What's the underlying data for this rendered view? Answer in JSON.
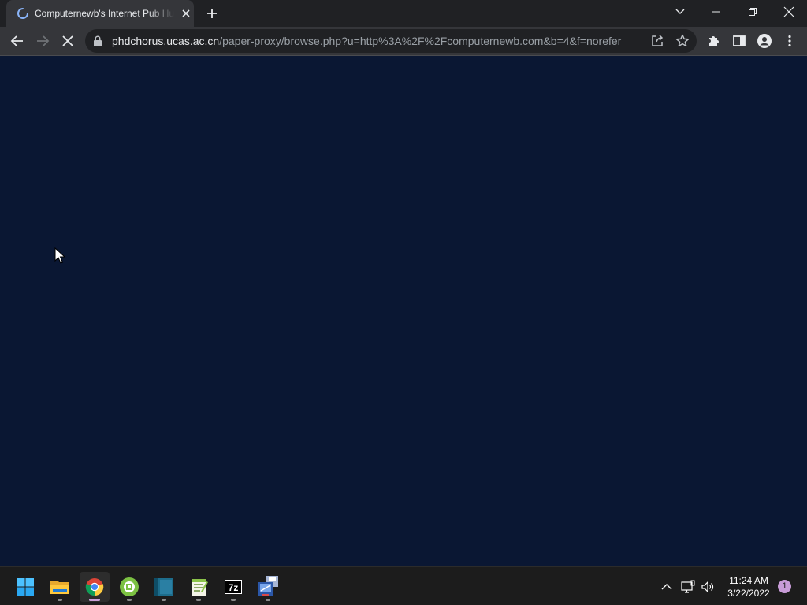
{
  "browser": {
    "tab": {
      "title": "Computernewb's Internet Pub Hub",
      "loading": true
    },
    "address": {
      "host": "phdchorus.ucas.ac.cn",
      "path": "/paper-proxy/browse.php?u=http%3A%2F%2Fcomputernewb.com&b=4&f=norefer"
    },
    "icons": {
      "back": "arrow-left-icon",
      "forward": "arrow-right-icon",
      "stop": "close-icon",
      "lock": "lock-icon",
      "share": "share-icon",
      "bookmark": "star-icon",
      "extensions": "puzzle-icon",
      "side_panel": "side-panel-icon",
      "profile": "profile-icon",
      "menu": "kebab-menu-icon"
    }
  },
  "page": {
    "background": "#0a1733"
  },
  "taskbar": {
    "apps": [
      {
        "name": "start",
        "icon": "windows-logo-icon"
      },
      {
        "name": "file-explorer",
        "icon": "folder-icon",
        "running": true
      },
      {
        "name": "chrome",
        "icon": "chrome-icon",
        "running": true,
        "active": true
      },
      {
        "name": "app-green",
        "icon": "green-app-icon",
        "running": true
      },
      {
        "name": "app-teal",
        "icon": "teal-book-icon",
        "running": true
      },
      {
        "name": "notepad-plus",
        "icon": "notepad-icon",
        "running": true
      },
      {
        "name": "7-zip",
        "icon": "7zip-icon",
        "label": "7z",
        "running": true
      },
      {
        "name": "control-panel",
        "icon": "control-panel-icon",
        "running": true
      }
    ],
    "clock": {
      "time": "11:24 AM",
      "date": "3/22/2022"
    },
    "notifications": "1"
  }
}
